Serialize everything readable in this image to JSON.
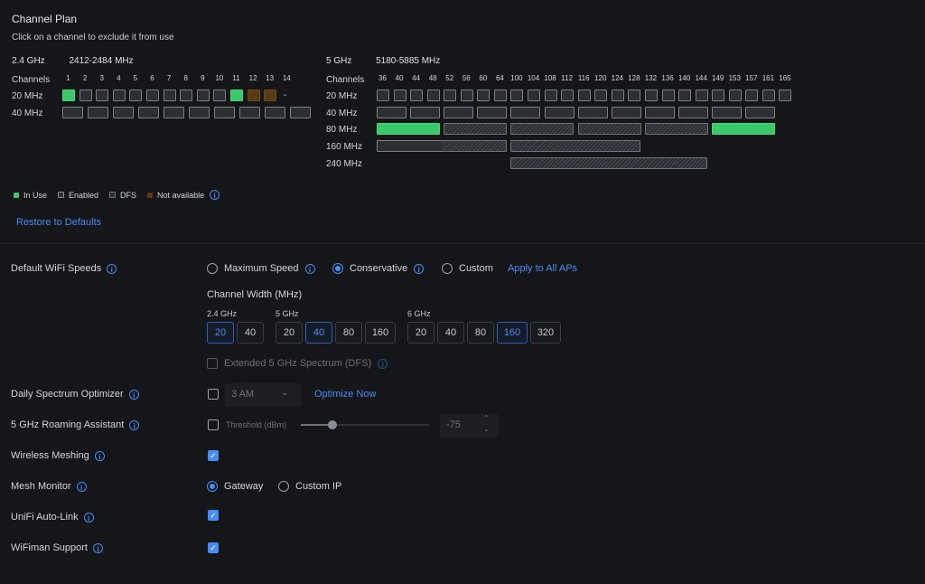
{
  "channel_plan": {
    "title": "Channel Plan",
    "subtitle": "Click on a channel to exclude it from use",
    "band24": {
      "name": "2.4 GHz",
      "range": "2412-2484 MHz",
      "channels_label": "Channels",
      "channels": [
        "1",
        "2",
        "3",
        "4",
        "5",
        "6",
        "7",
        "8",
        "9",
        "10",
        "11",
        "12",
        "13",
        "14"
      ],
      "row20_label": "20 MHz",
      "row40_label": "40 MHz",
      "ch14_value": "-"
    },
    "band5": {
      "name": "5 GHz",
      "range": "5180-5885 MHz",
      "channels_label": "Channels",
      "channels": [
        "36",
        "40",
        "44",
        "48",
        "52",
        "56",
        "60",
        "64",
        "100",
        "104",
        "108",
        "112",
        "116",
        "120",
        "124",
        "128",
        "132",
        "136",
        "140",
        "144",
        "149",
        "153",
        "157",
        "161",
        "165"
      ],
      "row_labels": [
        "20 MHz",
        "40 MHz",
        "80 MHz",
        "160 MHz",
        "240 MHz"
      ]
    },
    "legend": {
      "in_use": "In Use",
      "enabled": "Enabled",
      "dfs": "DFS",
      "not_available": "Not available"
    },
    "restore_label": "Restore to Defaults"
  },
  "colors": {
    "in_use": "#3bc76b",
    "enabled": "#2b2e33",
    "not_available": "#5a3b12",
    "accent": "#4b8cf2"
  },
  "settings": {
    "default_wifi_speeds": {
      "label": "Default WiFi Speeds",
      "options": [
        "Maximum Speed",
        "Conservative",
        "Custom"
      ],
      "selected": "Conservative",
      "apply_label": "Apply to All APs"
    },
    "channel_width": {
      "label": "Channel Width (MHz)",
      "band24": {
        "name": "2.4 GHz",
        "options": [
          "20",
          "40"
        ],
        "selected": "20"
      },
      "band5": {
        "name": "5 GHz",
        "options": [
          "20",
          "40",
          "80",
          "160"
        ],
        "selected": "40"
      },
      "band6": {
        "name": "6 GHz",
        "options": [
          "20",
          "40",
          "80",
          "160",
          "320"
        ],
        "selected": "160"
      }
    },
    "extended_dfs": {
      "label": "Extended 5 GHz Spectrum (DFS)",
      "checked": false
    },
    "daily_optimizer": {
      "label": "Daily Spectrum Optimizer",
      "checked": false,
      "time_value": "3 AM",
      "optimize_label": "Optimize Now"
    },
    "roaming_assistant": {
      "label": "5 GHz Roaming Assistant",
      "checked": false,
      "threshold_label": "Threshold (dBm)",
      "threshold_value": "-75",
      "slider_fraction": 0.25
    },
    "wireless_meshing": {
      "label": "Wireless Meshing",
      "checked": true
    },
    "mesh_monitor": {
      "label": "Mesh Monitor",
      "options": [
        "Gateway",
        "Custom IP"
      ],
      "selected": "Gateway"
    },
    "auto_link": {
      "label": "UniFi Auto-Link",
      "checked": true
    },
    "wifiman_support": {
      "label": "WiFiman Support",
      "checked": true
    }
  }
}
